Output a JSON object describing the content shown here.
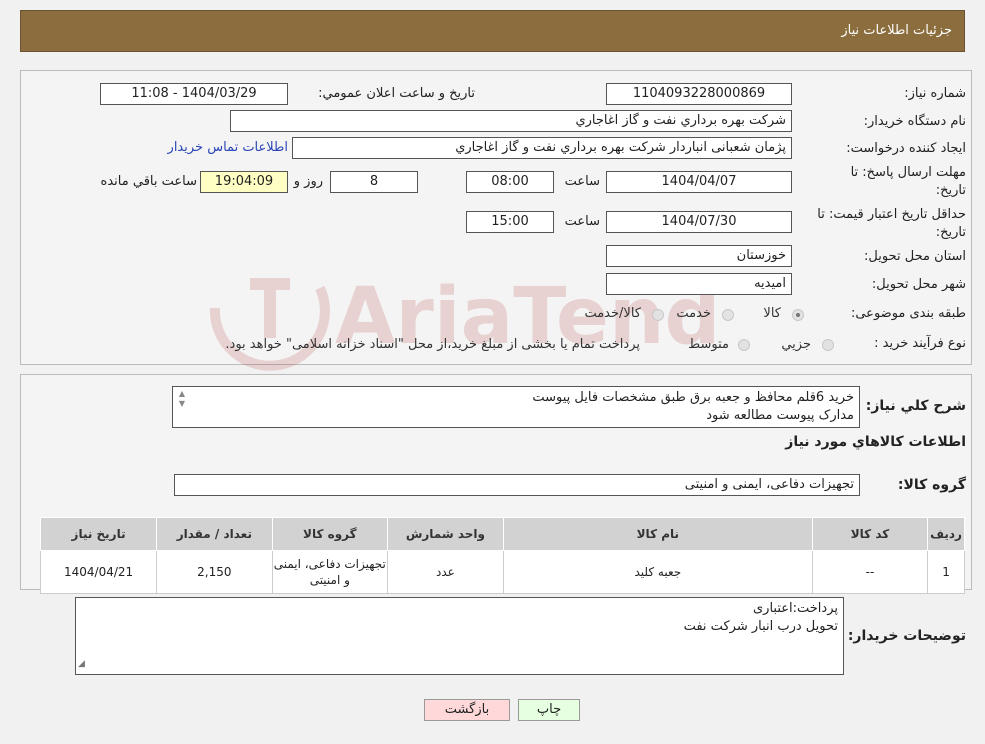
{
  "header": {
    "title": "جزئیات اطلاعات نیاز"
  },
  "form": {
    "need_number_label": "شماره نیاز:",
    "need_number": "1104093228000869",
    "announce_label": "تاریخ و ساعت اعلان عمومي:",
    "announce_value": "1404/03/29 - 11:08",
    "buyer_org_label": "نام دستگاه خريدار:",
    "buyer_org": "شركت بهره برداري نفت و گاز اغاجاري",
    "creator_label": "ايجاد کننده درخواست:",
    "creator": "پژمان شعبانی انباردار شركت بهره برداري نفت و گاز اغاجاري",
    "contact_link": "اطلاعات تماس خريدار",
    "reply_deadline_label_1": "مهلت ارسال پاسخ: تا",
    "reply_deadline_label_2": "تاریخ:",
    "reply_date": "1404/04/07",
    "time_label": "ساعت",
    "reply_time": "08:00",
    "days": "8",
    "days_label": "روز و",
    "remaining_time": "19:04:09",
    "remaining_label": "ساعت باقي مانده",
    "price_validity_label_1": "حداقل تاریخ اعتبار قیمت: تا",
    "price_validity_label_2": "تاریخ:",
    "price_validity_date": "1404/07/30",
    "price_validity_time": "15:00",
    "province_label": "استان محل تحویل:",
    "province": "خوزستان",
    "city_label": "شهر محل تحویل:",
    "city": "امیدیه",
    "category_label": "طبقه بندی موضوعی:",
    "category_options": [
      "كالا",
      "خدمت",
      "كالا/خدمت"
    ],
    "purchase_type_label": "نوع فرآیند خرید :",
    "purchase_options": [
      "جزيي",
      "متوسط"
    ],
    "purchase_note": "پرداخت تمام یا بخشی از مبلغ خرید،از محل \"اسناد خزانه اسلامی\" خواهد بود."
  },
  "details": {
    "description_label": "شرح كلي نياز:",
    "description_line1": "خريد 6قلم محافظ و جعبه برق طبق مشخصات فايل پيوست",
    "description_line2": "مدارک پیوست مطالعه شود",
    "items_heading": "اطلاعات كالاهاي مورد نياز",
    "group_label": "گروه كالا:",
    "group_value": "تجهیزات دفاعی، ایمنی و امنیتی",
    "table": {
      "headers": [
        "رديف",
        "كد كالا",
        "نام كالا",
        "واحد شمارش",
        "گروه كالا",
        "تعداد / مقدار",
        "تاريخ نياز"
      ],
      "rows": [
        [
          "1",
          "--",
          "جعبه کلید",
          "عدد",
          "تجهیزات دفاعی، ایمنی و امنیتی",
          "2,150",
          "1404/04/21"
        ]
      ]
    },
    "buyer_notes_label": "توضيحات خريدار:",
    "buyer_notes_line1": "پرداخت:اعتباری",
    "buyer_notes_line2": "تحویل درب انبار شرکت نفت"
  },
  "buttons": {
    "print": "چاپ",
    "back": "بازگشت"
  },
  "colors": {
    "header": "#8c6d3e",
    "back_button": "#ffd9d9",
    "print_button": "#e6ffe0",
    "remaining_bg": "#ffffc4"
  }
}
